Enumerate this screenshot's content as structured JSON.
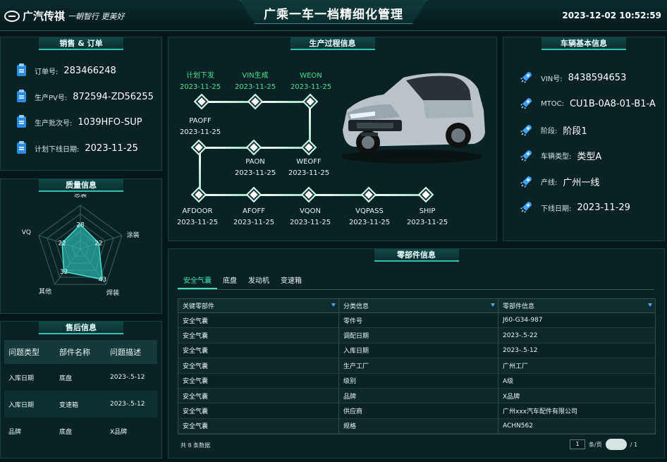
{
  "header": {
    "brand": "广汽传祺",
    "slogan": "一朝智行 更美好",
    "title": "广乘一车一档精细化管理",
    "datetime": "2023-12-02 10:52:59"
  },
  "sales": {
    "title": "销售 & 订单",
    "items": [
      {
        "label": "订单号:",
        "value": "283466248"
      },
      {
        "label": "生产PV号:",
        "value": "872594-ZD56255"
      },
      {
        "label": "生产批次号:",
        "value": "1039HFO-SUP"
      },
      {
        "label": "计划下线日期:",
        "value": "2023-11-25"
      }
    ]
  },
  "quality": {
    "title": "质量信息",
    "axes": [
      "总装",
      "涂装",
      "焊装",
      "其他",
      "VQ"
    ]
  },
  "chart_data": {
    "type": "radar",
    "title": "质量信息",
    "categories": [
      "总装",
      "涂装",
      "焊装",
      "其他",
      "VQ"
    ],
    "values": [
      28,
      22,
      43,
      32,
      22
    ]
  },
  "process": {
    "title": "生产过程信息",
    "nodes": [
      {
        "name": "计划下发",
        "date": "2023-11-25"
      },
      {
        "name": "VIN生成",
        "date": "2023-11-25"
      },
      {
        "name": "WEON",
        "date": "2023-11-25"
      },
      {
        "name": "PAOFF",
        "date": "2023-11-25"
      },
      {
        "name": "PAON",
        "date": "2023-11-25"
      },
      {
        "name": "WEOFF",
        "date": "2023-11-25"
      },
      {
        "name": "AFDOOR",
        "date": "2023-11-25"
      },
      {
        "name": "AFOFF",
        "date": "2023-11-25"
      },
      {
        "name": "VQON",
        "date": "2023-11-25"
      },
      {
        "name": "VQPASS",
        "date": "2023-11-25"
      },
      {
        "name": "SHIP",
        "date": "2023-11-25"
      }
    ]
  },
  "vehicle": {
    "title": "车辆基本信息",
    "items": [
      {
        "label": "VIN号:",
        "value": "8438594653"
      },
      {
        "label": "MTOC:",
        "value": "CU1B-0A8-01-B1-A"
      },
      {
        "label": "阶段:",
        "value": "阶段1"
      },
      {
        "label": "车辆类型:",
        "value": "类型A"
      },
      {
        "label": "产线:",
        "value": "广州一线"
      },
      {
        "label": "下线日期:",
        "value": "2023-11-29"
      }
    ]
  },
  "after_sales": {
    "title": "售后信息",
    "headers": [
      "问题类型",
      "部件名称",
      "问题描述"
    ],
    "rows": [
      [
        "入库日期",
        "底盘",
        "2023-.5-12"
      ],
      [
        "入库日期",
        "变速箱",
        "2023-.5-12"
      ],
      [
        "品牌",
        "底盘",
        "X品牌"
      ]
    ]
  },
  "parts": {
    "title": "零部件信息",
    "tabs": [
      "安全气囊",
      "底盘",
      "发动机",
      "变速箱"
    ],
    "headers": [
      "关键零部件",
      "分类信息",
      "零部件信息"
    ],
    "rows": [
      [
        "安全气囊",
        "零件号",
        "J60-G34-987"
      ],
      [
        "安全气囊",
        "调配日期",
        "2023-.5-22"
      ],
      [
        "安全气囊",
        "入库日期",
        "2023-.5-12"
      ],
      [
        "安全气囊",
        "生产工厂",
        "广州工厂"
      ],
      [
        "安全气囊",
        "级别",
        "A级"
      ],
      [
        "安全气囊",
        "品牌",
        "X品牌"
      ],
      [
        "安全气囊",
        "供应商",
        "广州xxx汽车配件有限公司"
      ],
      [
        "安全气囊",
        "规格",
        "ACHN562"
      ]
    ],
    "total": "共 8 条数据",
    "page": "1",
    "page_size_label": "条/页",
    "page_of": "/ 1"
  },
  "colors": {
    "accent": "#2fc3b5",
    "green": "#3de08e",
    "background": "#06171a"
  }
}
